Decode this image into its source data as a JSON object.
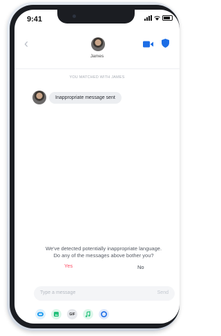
{
  "status_bar": {
    "time": "9:41"
  },
  "header": {
    "name": "James"
  },
  "chat": {
    "match_label": "YOU MATCHED WITH JAMES",
    "message": "Inappropriate message sent"
  },
  "prompt": {
    "line1": "We've detected potentially inappropriate language.",
    "line2": "Do any of the messages above bother you?",
    "yes": "Yes",
    "no": "No"
  },
  "composer": {
    "placeholder": "Type a message",
    "send": "Send"
  },
  "toolbar": {
    "gif_label": "GIF"
  },
  "icons": [
    "back-icon",
    "video-icon",
    "shield-icon",
    "sticker-icon",
    "gif-icon",
    "music-icon",
    "loop-icon"
  ],
  "colors": {
    "accent": "#fd5068",
    "brand_blue": "#1d6ee6",
    "green": "#22c07a"
  }
}
